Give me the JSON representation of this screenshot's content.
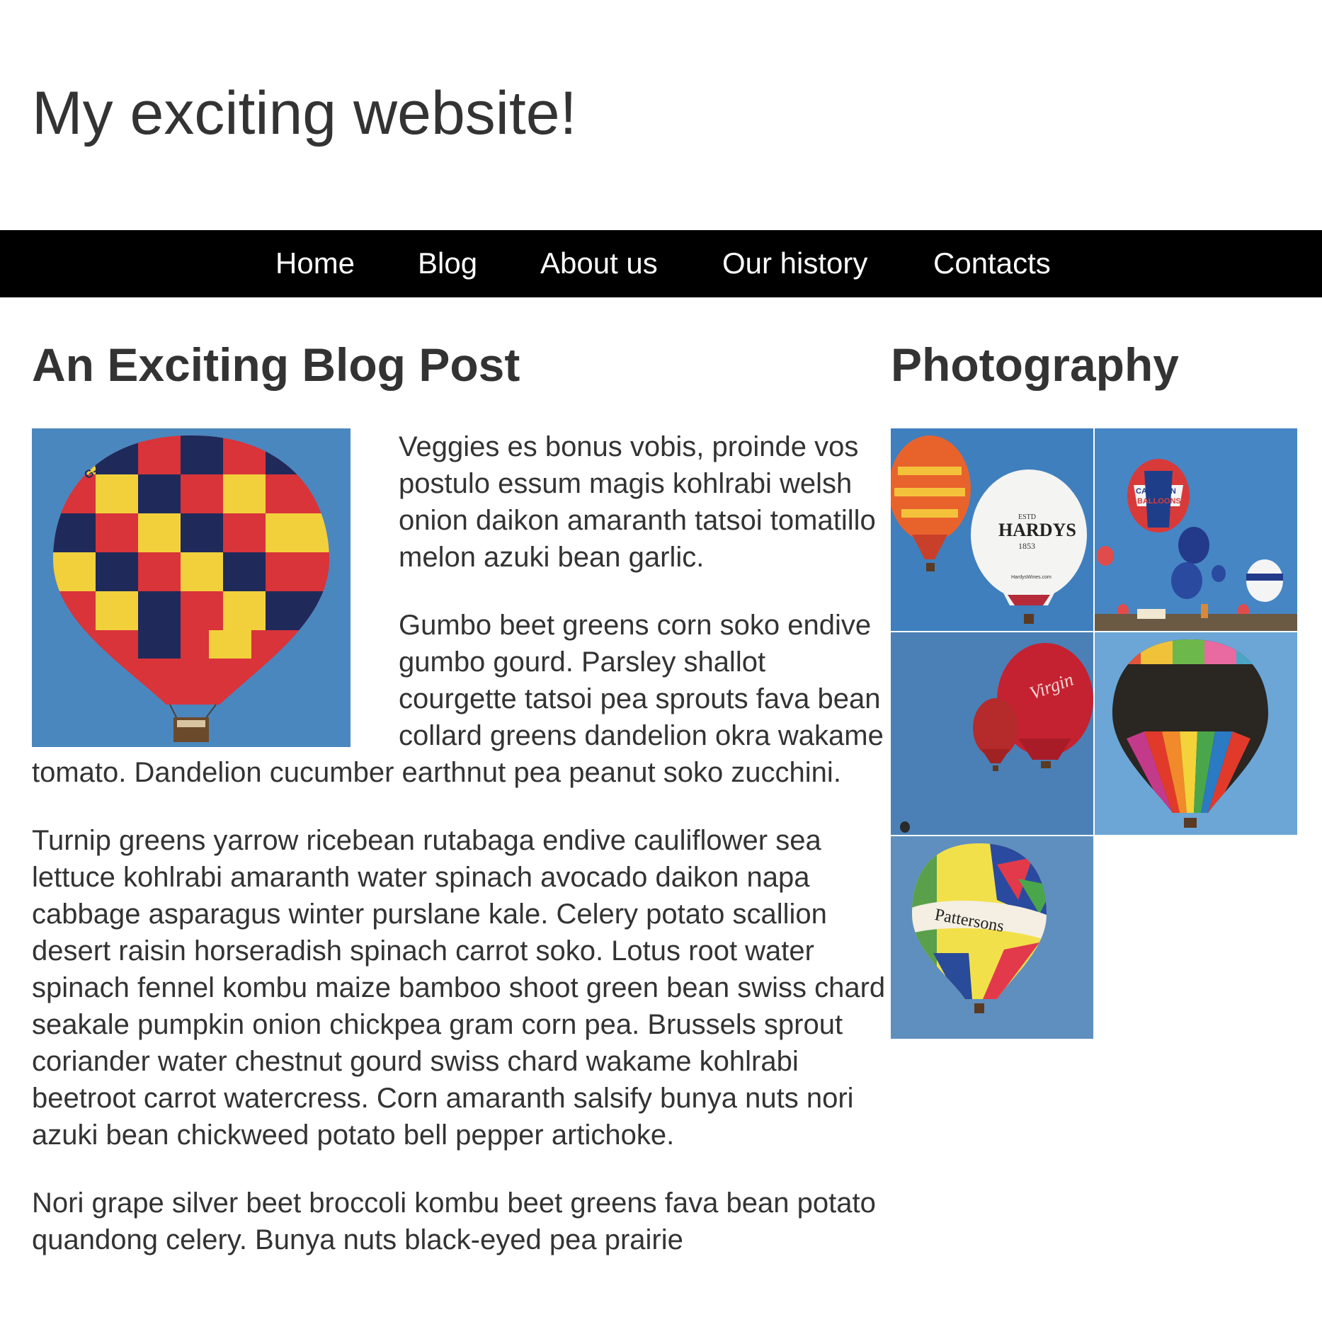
{
  "header": {
    "site_title": "My exciting website!"
  },
  "nav": {
    "items": [
      {
        "label": "Home"
      },
      {
        "label": "Blog"
      },
      {
        "label": "About us"
      },
      {
        "label": "Our history"
      },
      {
        "label": "Contacts"
      }
    ]
  },
  "main": {
    "post_title": "An Exciting Blog Post",
    "paragraphs": [
      "Veggies es bonus vobis, proinde vos postulo essum magis kohlrabi welsh onion daikon amaranth tatsoi tomatillo melon azuki bean garlic.",
      "Gumbo beet greens corn soko endive gumbo gourd. Parsley shallot courgette tatsoi pea sprouts fava bean collard greens dandelion okra wakame tomato. Dandelion cucumber earthnut pea peanut soko zucchini.",
      "Turnip greens yarrow ricebean rutabaga endive cauliflower sea lettuce kohlrabi amaranth water spinach avocado daikon napa cabbage asparagus winter purslane kale. Celery potato scallion desert raisin horseradish spinach carrot soko. Lotus root water spinach fennel kombu maize bamboo shoot green bean swiss chard seakale pumpkin onion chickpea gram corn pea. Brussels sprout coriander water chestnut gourd swiss chard wakame kohlrabi beetroot carrot watercress. Corn amaranth salsify bunya nuts nori azuki bean chickweed potato bell pepper artichoke.",
      "Nori grape silver beet broccoli kombu beet greens fava bean potato quandong celery. Bunya nuts black-eyed pea prairie"
    ],
    "feature_image": {
      "icon": "hot-air-balloon-photo",
      "balloon_text": "G-HPCB"
    }
  },
  "sidebar": {
    "title": "Photography",
    "gallery": [
      {
        "icon": "balloon-photo-hardys",
        "text_1": "ESTD",
        "text_2": "HARDYS",
        "text_3": "1853",
        "text_4": "HardysWines.com"
      },
      {
        "icon": "balloon-photo-cameron",
        "text_1": "CAMERON",
        "text_2": "BALLOONS"
      },
      {
        "icon": "balloon-photo-virgin",
        "text_1": "Virgin"
      },
      {
        "icon": "balloon-photo-rainbow"
      },
      {
        "icon": "balloon-photo-pattersons",
        "text_1": "Pattersons"
      }
    ]
  },
  "colors": {
    "nav_background": "#000000",
    "nav_text": "#ffffff",
    "text": "#333333",
    "sky": "#4a87bf"
  }
}
